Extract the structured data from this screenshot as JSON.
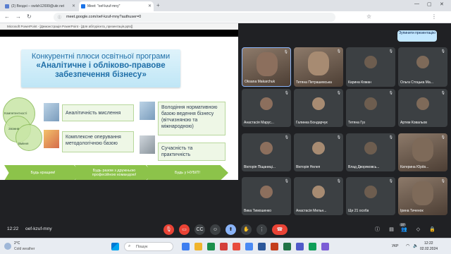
{
  "tabs": [
    {
      "label": "(2) Входні – owlsh12699@ukr.net",
      "color": "#5a7fd0"
    },
    {
      "label": "Meet: \"oef-kzuf-mny\"",
      "color": "#1a73e8"
    }
  ],
  "address": "meet.google.com/oef-kzuf-mny?authuser=0",
  "presentation": {
    "window_title": "Microsoft PowerPoint - [Демонстрація PowerPoint - [Для абітурієнта_презентація.pptx]]",
    "slide_title_1": "Конкурентні плюси освітньої програми",
    "slide_title_2": "«Аналітичне і обліково-правове",
    "slide_title_3": "забезпечення бізнесу»",
    "circles": [
      "Компетентності",
      "Знання",
      "Вміння"
    ],
    "skills": [
      "Аналітичність мислення",
      "Володіння нормативною базою ведення бізнесу (вітчизняною та міжнародною)",
      "Комплексне оперування методологічною базою",
      "Сучасність та практичність"
    ],
    "arrows": [
      "Будь кращим!",
      "Будь разом з дружньою професійною командою!",
      "Будь у НУБІП!"
    ]
  },
  "meet": {
    "present_banner": "Зупинити презентацію",
    "participants": [
      {
        "name": "Oksana Makarchuk",
        "video": true
      },
      {
        "name": "Тетяна Петрашевська",
        "video": true
      },
      {
        "name": "Карина Коман",
        "video": false
      },
      {
        "name": "Ольга Стоцька Ма...",
        "video": false
      },
      {
        "name": "Анастасія Марус...",
        "video": false
      },
      {
        "name": "Галинка Бондарчук",
        "video": false
      },
      {
        "name": "Тетяна Гуз",
        "video": false
      },
      {
        "name": "Артем Ковальов",
        "video": false
      },
      {
        "name": "Вікторія Піщаниці...",
        "video": false
      },
      {
        "name": "Вікторія Нелеп",
        "video": false
      },
      {
        "name": "Влад Дворяковсь...",
        "video": false
      },
      {
        "name": "Катерина Юріїв...",
        "video": true
      },
      {
        "name": "Вика Тимошенко",
        "video": false
      },
      {
        "name": "Анастасія Мельн...",
        "video": false
      },
      {
        "name": "Ще 21 особа",
        "video": false
      },
      {
        "name": "Ірина Тиченок",
        "video": true
      }
    ],
    "clock": "12:22",
    "meeting_code": "oef-kzuf-mny",
    "participant_count": "37"
  },
  "taskbar": {
    "temp": "2°C",
    "weather": "Cold weather",
    "search": "Пошук",
    "lang": "УКР",
    "time": "12:22",
    "date": "02.02.2024"
  }
}
